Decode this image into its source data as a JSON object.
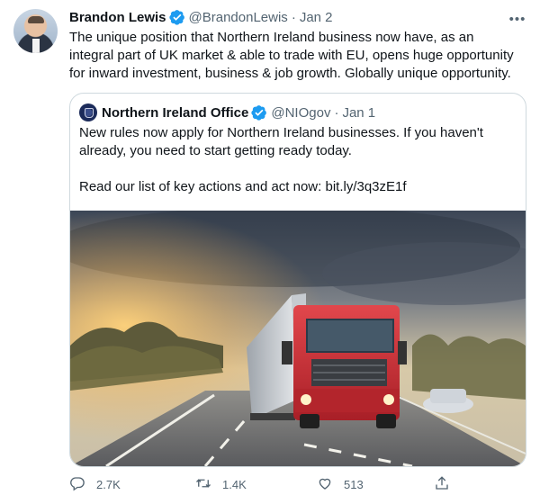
{
  "tweet": {
    "author": "Brandon Lewis",
    "handle": "@BrandonLewis",
    "separator": "·",
    "date": "Jan 2",
    "text": "The unique position that Northern Ireland business now have, as an integral part of UK market & able to trade with EU, opens huge opportunity for inward investment, business & job growth. Globally unique opportunity.",
    "more_label": "•••"
  },
  "quote": {
    "author": "Northern Ireland Office",
    "handle": "@NIOgov",
    "separator": "·",
    "date": "Jan 1",
    "paragraph1": "New rules now apply for Northern Ireland businesses. If you haven't already, you need to start getting ready today.",
    "paragraph2": "Read our list of key actions and act now: bit.ly/3q3zE1f"
  },
  "actions": {
    "reply_count": "2.7K",
    "retweet_count": "1.4K",
    "like_count": "513"
  },
  "colors": {
    "verified": "#1d9bf0",
    "muted": "#536471",
    "border": "#cfd9de",
    "truck": "#d9363e"
  },
  "icons": [
    "verified-icon",
    "more-icon",
    "reply-icon",
    "retweet-icon",
    "like-icon",
    "share-icon"
  ]
}
